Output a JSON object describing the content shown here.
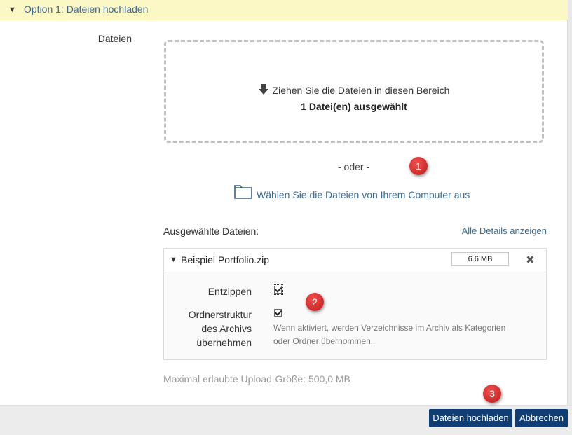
{
  "panel": {
    "title": "Option 1: Dateien hochladen"
  },
  "files_field": {
    "label": "Dateien"
  },
  "dropzone": {
    "instruction": "Ziehen Sie die Dateien in diesen Bereich",
    "selected_count": "1 Datei(en) ausgewählt"
  },
  "separator": "- oder -",
  "choose_link": "Wählen Sie die Dateien von Ihrem Computer aus",
  "selected_files": {
    "label": "Ausgewählte Dateien:",
    "details_link": "Alle Details anzeigen",
    "items": [
      {
        "name": "Beispiel Portfolio.zip",
        "size": "6.6 MB"
      }
    ]
  },
  "options": {
    "unzip": {
      "label": "Entzippen",
      "checked": true
    },
    "folder_structure": {
      "label_line1": "Ordnerstruktur",
      "label_line2": "des Archivs",
      "label_line3": "übernehmen",
      "checked": true,
      "help_line1": "Wenn aktiviert, werden Verzeichnisse im Archiv als Kategorien",
      "help_line2": "oder Ordner übernommen."
    }
  },
  "max_upload": "Maximal erlaubte Upload-Größe: 500,0 MB",
  "callouts": [
    "1",
    "2",
    "3"
  ],
  "buttons": {
    "upload": "Dateien hochladen",
    "cancel": "Abbrechen"
  },
  "colors": {
    "link": "#3b6b96",
    "primary_button": "#0e3e73",
    "header_bg": "#fbf8c6",
    "badge": "#d42626"
  },
  "icons": [
    "caret-down-icon",
    "download-arrow-icon",
    "folder-icon",
    "remove-x-icon"
  ]
}
